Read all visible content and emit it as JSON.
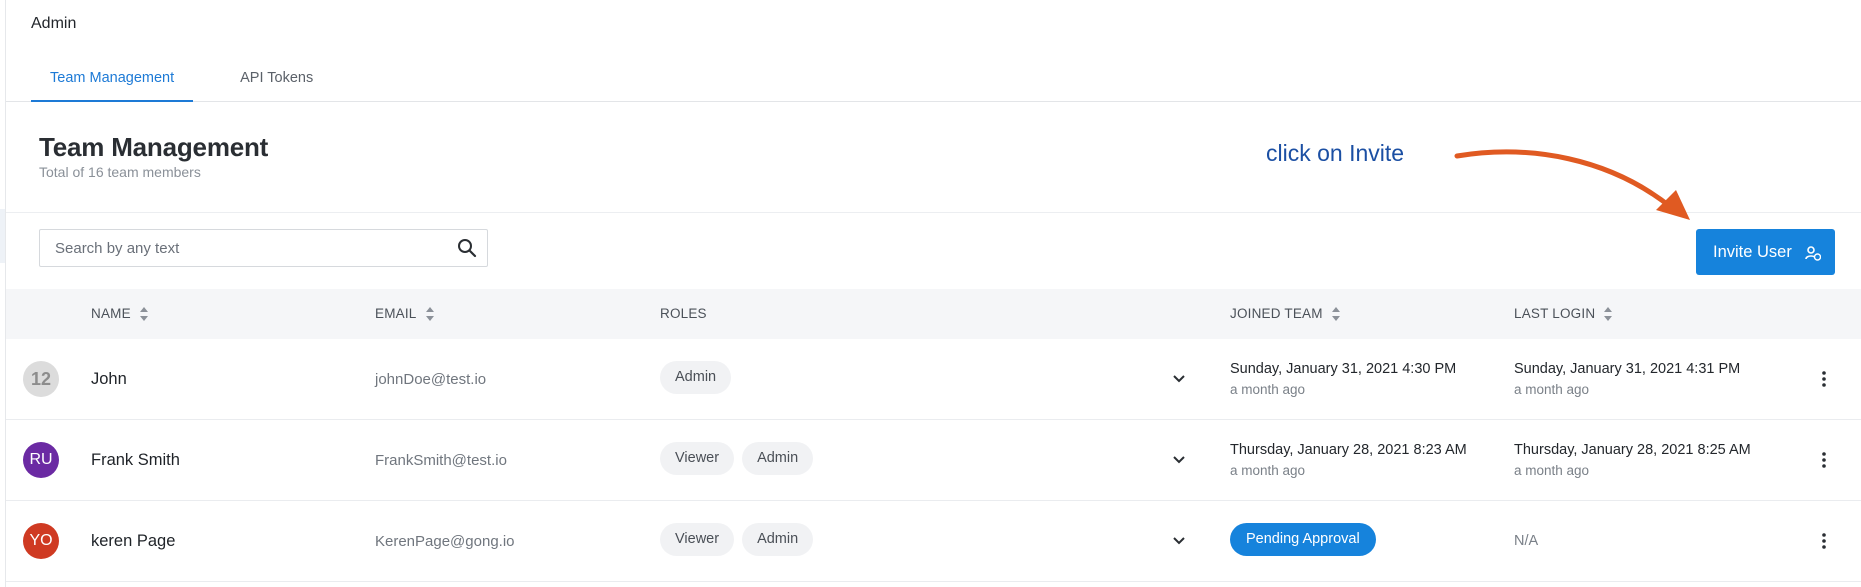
{
  "app": {
    "title": "Admin"
  },
  "tabs": [
    {
      "label": "Team Management",
      "active": true
    },
    {
      "label": "API Tokens",
      "active": false
    }
  ],
  "section": {
    "title": "Team Management",
    "subtitle": "Total of 16 team members"
  },
  "annotation": {
    "text": "click on Invite",
    "color": "#e05a22"
  },
  "search": {
    "placeholder": "Search by any text",
    "value": ""
  },
  "invite_button": {
    "label": "Invite User",
    "color": "#1683dc"
  },
  "table": {
    "columns": [
      {
        "label": "NAME",
        "sortable": true
      },
      {
        "label": "EMAIL",
        "sortable": true
      },
      {
        "label": "ROLES",
        "sortable": false
      },
      {
        "label": "JOINED TEAM",
        "sortable": true
      },
      {
        "label": "LAST LOGIN",
        "sortable": true
      }
    ],
    "rows": [
      {
        "avatar_text": "12",
        "avatar_color": "#dcdcdc",
        "name": "John",
        "email": "johnDoe@test.io",
        "roles": [
          "Admin"
        ],
        "joined": {
          "date": "Sunday, January 31, 2021 4:30 PM",
          "relative": "a month ago"
        },
        "last_login": {
          "date": "Sunday, January 31, 2021 4:31 PM",
          "relative": "a month ago"
        }
      },
      {
        "avatar_text": "RU",
        "avatar_color": "#6b2aa3",
        "name": "Frank Smith",
        "email": "FrankSmith@test.io",
        "roles": [
          "Viewer",
          "Admin"
        ],
        "joined": {
          "date": "Thursday, January 28, 2021 8:23 AM",
          "relative": "a month ago"
        },
        "last_login": {
          "date": "Thursday, January 28, 2021 8:25 AM",
          "relative": "a month ago"
        }
      },
      {
        "avatar_text": "YO",
        "avatar_color": "#cf3a22",
        "name": "keren Page",
        "email": "KerenPage@gong.io",
        "roles": [
          "Viewer",
          "Admin"
        ],
        "joined": {
          "status": "Pending Approval"
        },
        "last_login": {
          "text": "N/A"
        }
      }
    ]
  }
}
